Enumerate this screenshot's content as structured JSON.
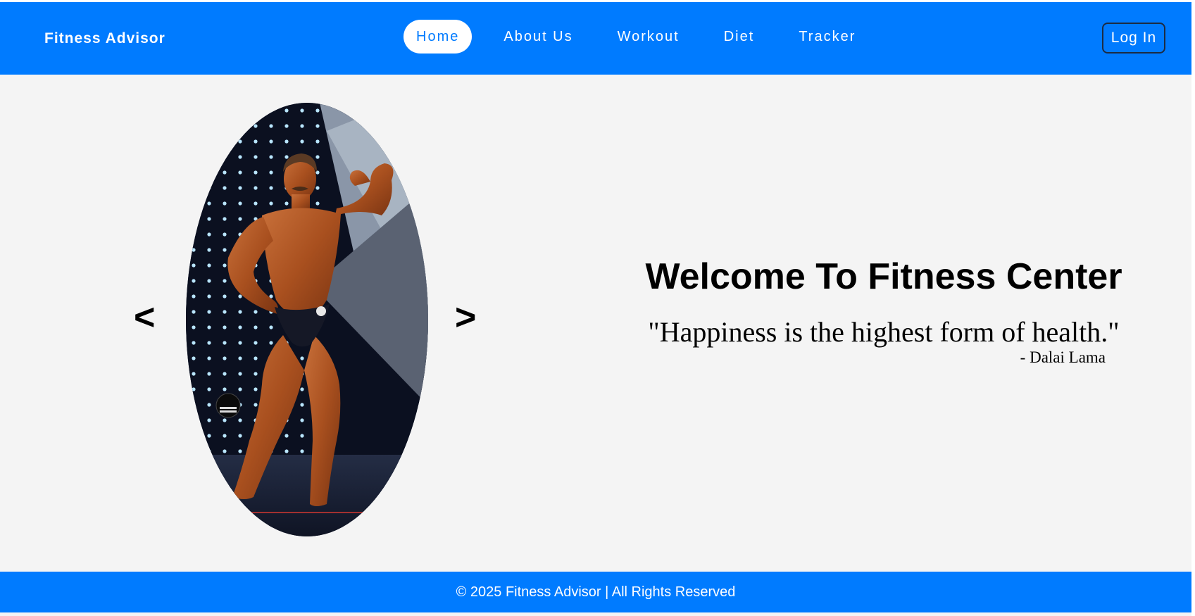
{
  "nav": {
    "brand": "Fitness Advisor",
    "links": [
      {
        "label": "Home",
        "active": true
      },
      {
        "label": "About Us",
        "active": false
      },
      {
        "label": "Workout",
        "active": false
      },
      {
        "label": "Diet",
        "active": false
      },
      {
        "label": "Tracker",
        "active": false
      }
    ],
    "login_label": "Log In"
  },
  "hero": {
    "prev_label": "<",
    "next_label": ">",
    "image_alt": "bodybuilder-posing-photo",
    "heading": "Welcome To Fitness Center",
    "quote": "\"Happiness is the highest form of health.\"",
    "author": "- Dalai Lama"
  },
  "footer": {
    "text": "© 2025 Fitness Advisor | All Rights Reserved"
  },
  "colors": {
    "primary": "#007bff",
    "background": "#f4f4f4",
    "text": "#000000"
  }
}
